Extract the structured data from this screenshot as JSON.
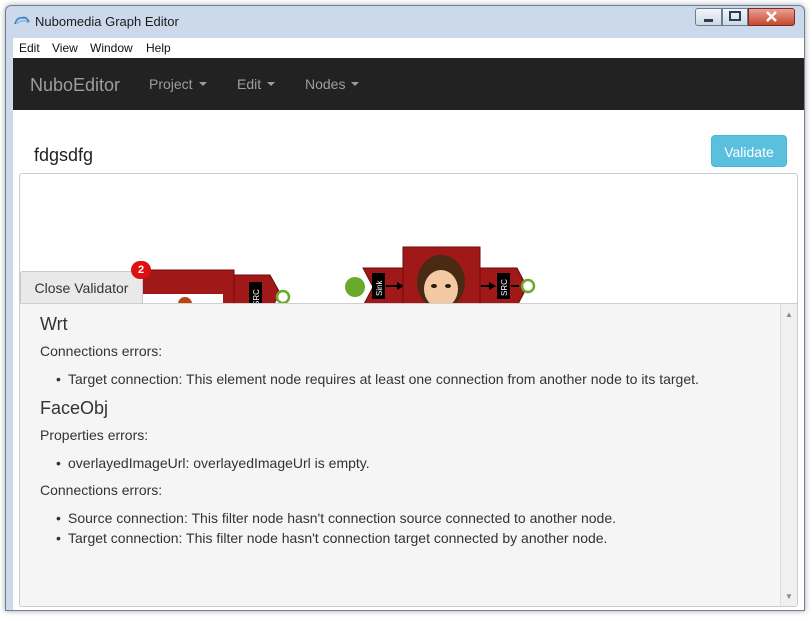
{
  "window": {
    "title": "Nubomedia Graph Editor"
  },
  "menubar": {
    "items": [
      "Edit",
      "View",
      "Window",
      "Help"
    ]
  },
  "navbar": {
    "brand": "NuboEditor",
    "links": [
      "Project",
      "Edit",
      "Nodes"
    ]
  },
  "page": {
    "graph_name": "fdgsdfg",
    "validate_label": "Validate"
  },
  "canvas": {
    "node1": {
      "port_label": "SRC"
    },
    "node2": {
      "sink_label": "Sink",
      "src_label": "SRC"
    }
  },
  "validator": {
    "close_label": "Close Validator",
    "badge_count": "2",
    "entries": [
      {
        "title": "Wrt",
        "sections": [
          {
            "label": "Connections errors:",
            "items": [
              "Target connection: This element node requires at least one connection from another node to its target."
            ]
          }
        ]
      },
      {
        "title": "FaceObj",
        "sections": [
          {
            "label": "Properties errors:",
            "items": [
              "overlayedImageUrl: overlayedImageUrl is empty."
            ]
          },
          {
            "label": "Connections errors:",
            "items": [
              "Source connection: This filter node hasn't connection source connected to another node.",
              "Target connection: This filter node hasn't connection target connected by another node."
            ]
          }
        ]
      }
    ]
  },
  "colors": {
    "navbar": "#222222",
    "accent": "#5bc0de",
    "node_red": "#a01818",
    "port_green": "#6aaa2a",
    "badge": "#dd1111"
  }
}
